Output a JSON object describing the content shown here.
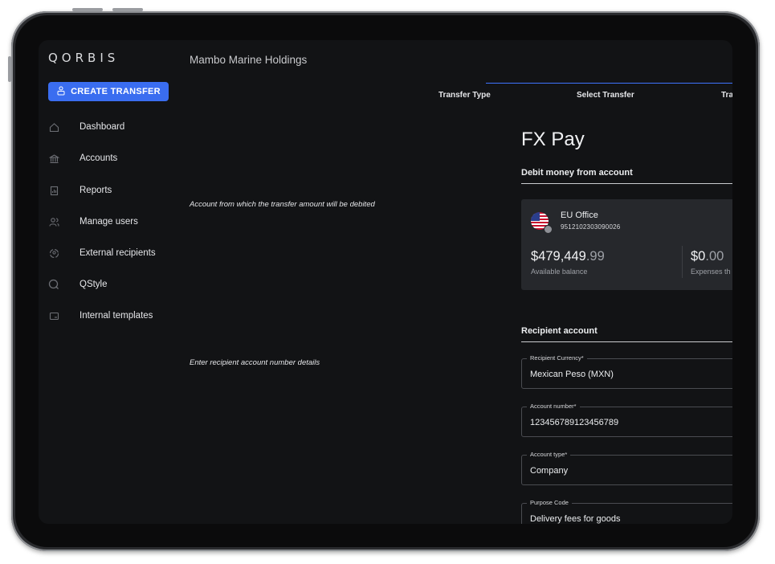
{
  "app": {
    "logo": "QORBIS",
    "create_button": "CREATE TRANSFER"
  },
  "sidebar": {
    "items": [
      {
        "label": "Dashboard",
        "icon": "home-icon"
      },
      {
        "label": "Accounts",
        "icon": "bank-icon"
      },
      {
        "label": "Reports",
        "icon": "report-icon"
      },
      {
        "label": "Manage users",
        "icon": "users-icon"
      },
      {
        "label": "External recipients",
        "icon": "recipients-icon"
      },
      {
        "label": "QStyle",
        "icon": "qstyle-icon"
      },
      {
        "label": "Internal templates",
        "icon": "templates-icon"
      }
    ]
  },
  "header": {
    "org_name": "Mambo Marine Holdings"
  },
  "steps": [
    "Transfer Type",
    "Select Transfer",
    "Tra"
  ],
  "hints": {
    "debit": "Account from which the transfer amount will be debited",
    "recipient": "Enter recipient account number details"
  },
  "page": {
    "title": "FX Pay",
    "debit_section": "Debit money from account",
    "recipient_section": "Recipient account"
  },
  "account_card": {
    "name": "EU Office",
    "number": "9512102303090026",
    "flag_icon": "us-flag-icon",
    "balance_main": "$479,449",
    "balance_decimals": ".99",
    "balance_label": "Available balance",
    "expenses_main": "$0",
    "expenses_decimals": ".00",
    "expenses_label": "Expenses th"
  },
  "form": {
    "fields": [
      {
        "label": "Recipient Currency*",
        "value": "Mexican Peso (MXN)"
      },
      {
        "label": "Account number*",
        "value": "123456789123456789"
      },
      {
        "label": "Account type*",
        "value": "Company"
      },
      {
        "label": "Purpose Code",
        "value": "Delivery fees for goods"
      }
    ]
  },
  "colors": {
    "accent": "#3a6df0",
    "background": "#121315",
    "card": "#26282c"
  }
}
